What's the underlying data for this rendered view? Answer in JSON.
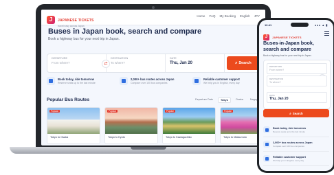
{
  "brand": {
    "name": "JAPANESE TICKETS",
    "tagline": "travel easy across Japan",
    "accent": "#e2372b",
    "button_color": "#ec4a1d",
    "navy": "#1d2a4d"
  },
  "desktop": {
    "nav": [
      "Home",
      "FAQ",
      "My Booking",
      "English",
      "JPY"
    ],
    "title": "Buses in Japan book, search and compare",
    "subtitle": "Book a highway bus for your next trip in Japan.",
    "search": {
      "from_label": "DEPARTURE",
      "from_placeholder": "From where?",
      "to_label": "DESTINATION",
      "to_placeholder": "To where?",
      "date_label": "DATE",
      "date_value": "Thu, Jan 20",
      "button": "Search"
    },
    "features": [
      {
        "title": "Book today, ride tomorrow",
        "sub": "Reserve seats up to the last minute",
        "icon": "calendar-icon"
      },
      {
        "title": "2,000+ bus routes across Japan",
        "sub": "Compare over 100 bus companies",
        "icon": "bus-icon"
      },
      {
        "title": "Reliable customer support",
        "sub": "We help you in English, every day",
        "icon": "support-icon"
      }
    ],
    "routes_title": "Popular Bus Routes",
    "route_tabs": [
      "Departure Date",
      "Tokyo",
      "Osaka",
      "Nagoya"
    ],
    "routes": [
      {
        "label": "Tokyo to Osaka",
        "tag": "Popular"
      },
      {
        "label": "Tokyo to Kyoto",
        "tag": "Popular"
      },
      {
        "label": "Tokyo to Kawaguchiko",
        "tag": "Popular"
      },
      {
        "label": "Tokyo to Matsumoto",
        "tag": "Popular"
      }
    ]
  },
  "mobile": {
    "status_time": "10:41",
    "status_icons": "●●● ▲ ▮",
    "title": "Buses in Japan book, search and compare",
    "subtitle": "Book a highway bus for your next trip in Japan.",
    "search": {
      "from_label": "DEPARTURE",
      "from_placeholder": "From where?",
      "to_label": "DESTINATION",
      "to_placeholder": "To where?",
      "date_label": "DATE",
      "date_value": "Thu, Jan 20",
      "button": "Search"
    },
    "features": [
      {
        "title": "Book today, ride tomorrow",
        "sub": "Reserve seats up to the last minute",
        "icon": "calendar-icon"
      },
      {
        "title": "2,000+ bus routes across Japan",
        "sub": "Compare over 100 bus companies",
        "icon": "bus-icon"
      },
      {
        "title": "Reliable customer support",
        "sub": "We help you in English, every day",
        "icon": "support-icon"
      }
    ]
  }
}
